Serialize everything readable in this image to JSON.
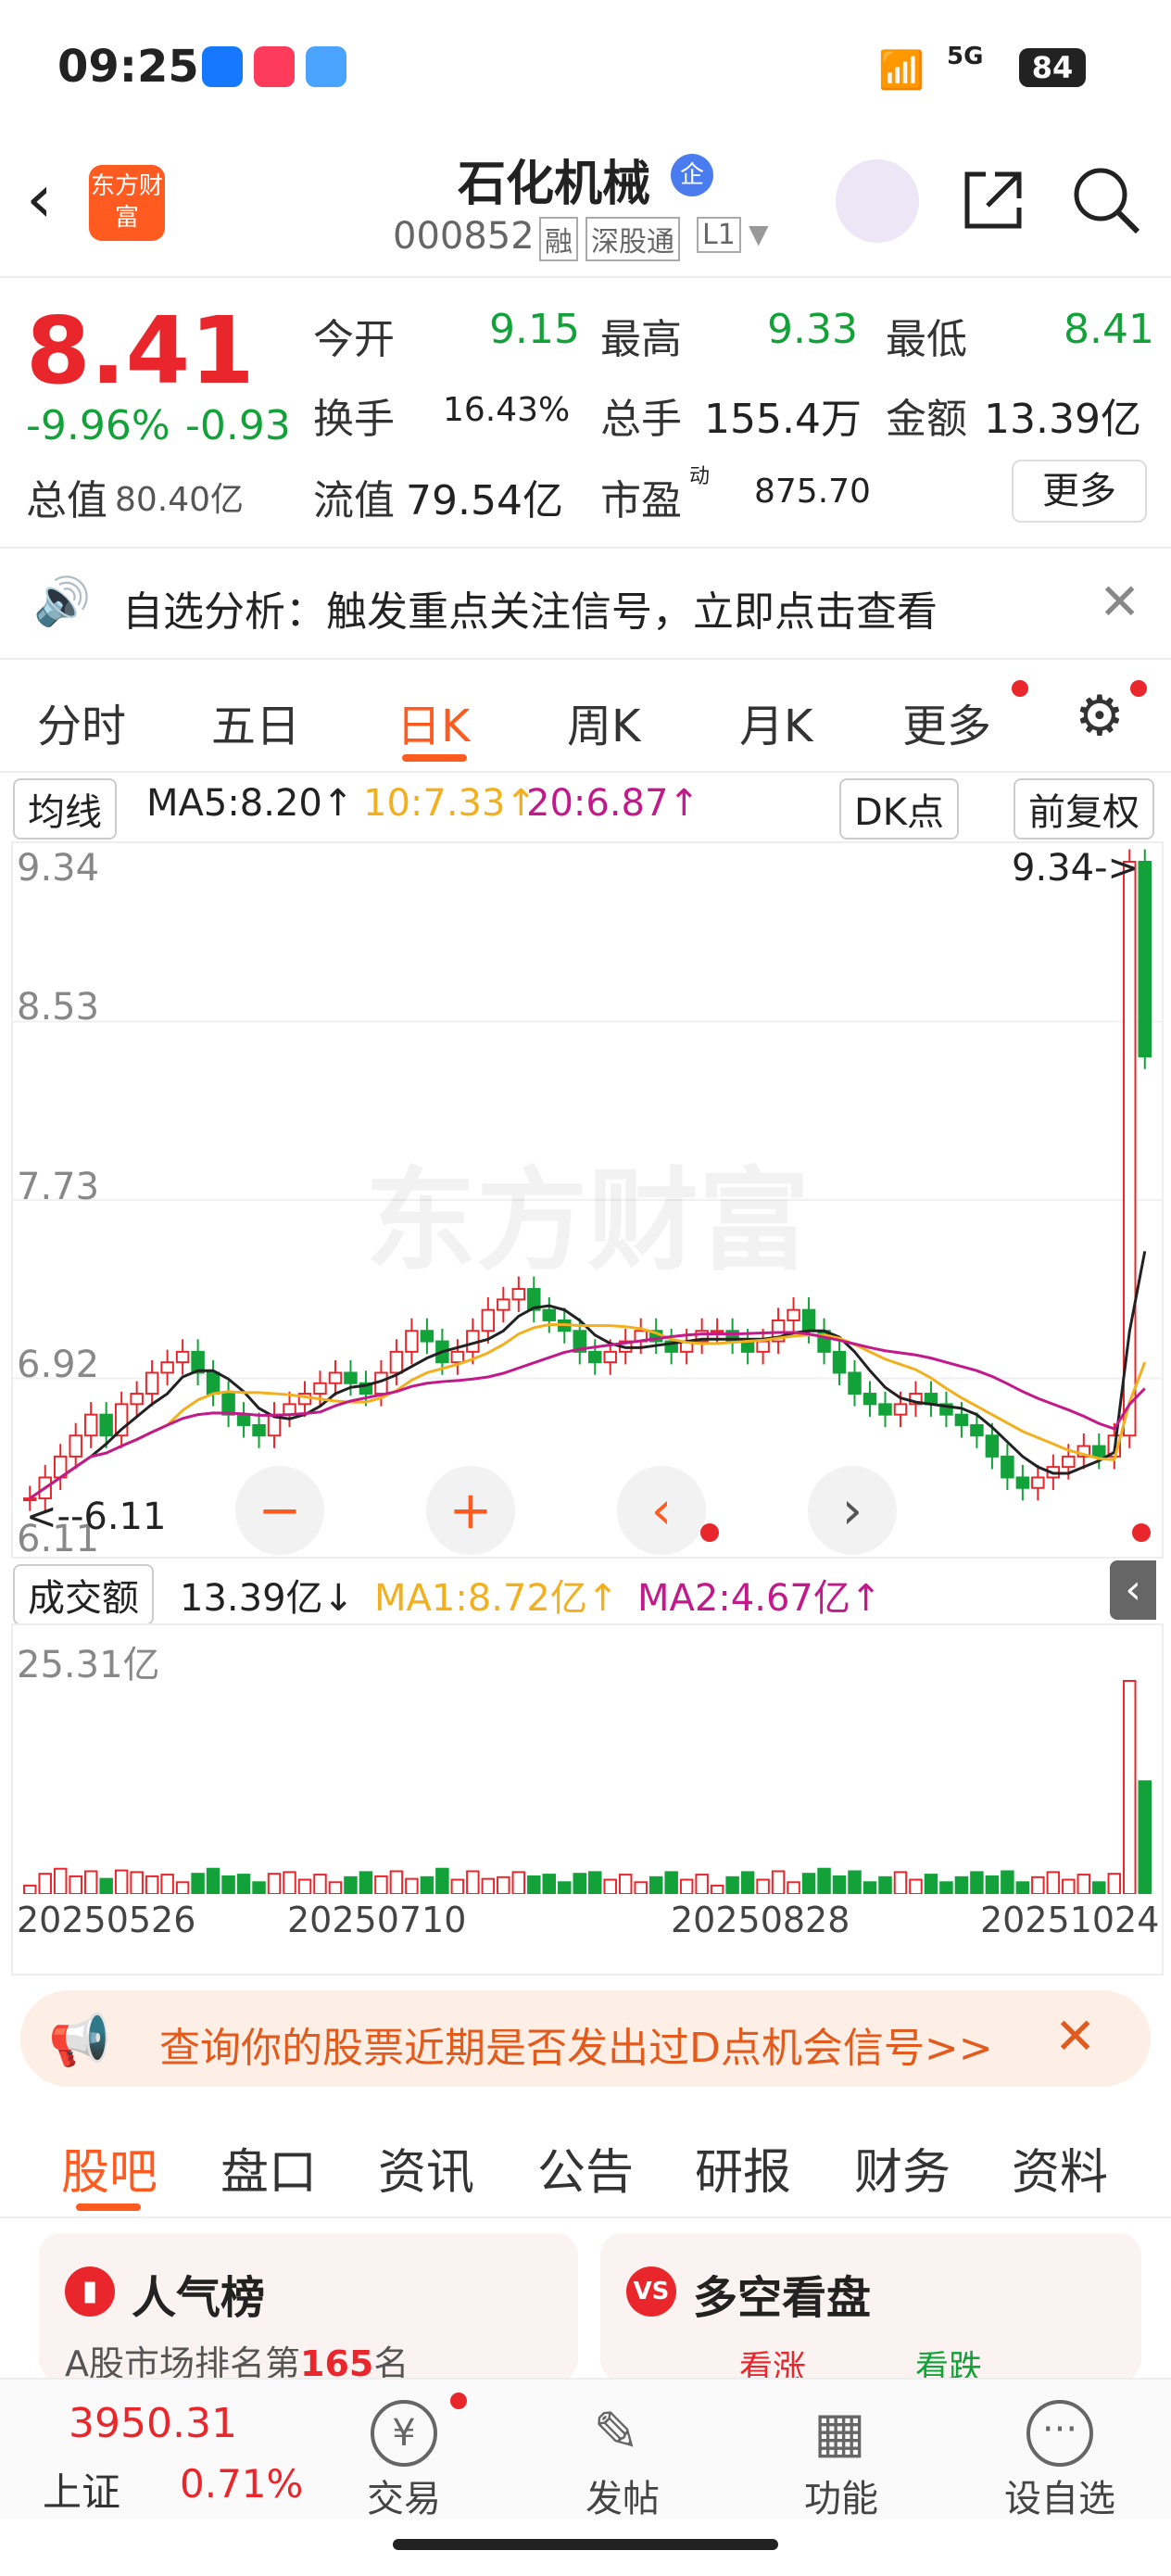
{
  "status": {
    "time": "09:25",
    "signal": "5G",
    "battery": "84"
  },
  "header": {
    "logo": "东方财富",
    "title": "石化机械",
    "badge": "企",
    "code": "000852",
    "tags": [
      "融",
      "深股通",
      "L1"
    ]
  },
  "quote": {
    "price": "8.41",
    "pct": "-9.96%",
    "chg": "-0.93",
    "open_label": "今开",
    "open": "9.15",
    "high_label": "最高",
    "high": "9.33",
    "low_label": "最低",
    "low": "8.41",
    "turnover_label": "换手",
    "turnover": "16.43%",
    "vol_label": "总手",
    "vol": "155.4万",
    "amt_label": "金额",
    "amt": "13.39亿",
    "mcap_label": "总值",
    "mcap": "80.40亿",
    "fcap_label": "流值",
    "fcap": "79.54亿",
    "pe_label": "市盈",
    "pe_sup": "动",
    "pe": "875.70",
    "more": "更多"
  },
  "alert": {
    "text": "自选分析：触发重点关注信号，立即点击查看"
  },
  "tabs": [
    "分时",
    "五日",
    "日K",
    "周K",
    "月K",
    "更多"
  ],
  "chart": {
    "ma_select": "均线",
    "ma5": "MA5:8.20↑",
    "ma10": "10:7.33↑",
    "ma20": "20:6.87↑",
    "dk": "DK点",
    "fq": "前复权",
    "ytick_top": "9.34",
    "ytick_2": "8.53",
    "ytick_3": "7.73",
    "ytick_4": "6.92",
    "high_mark": "9.34->",
    "low_mark": "<--6.11",
    "low_axis": "6.11",
    "watermark": "东方财富",
    "vol_select": "成交额",
    "vol_val": "13.39亿↓",
    "ma1": "MA1:8.72亿↑",
    "ma2": "MA2:4.67亿↑",
    "vol_top": "25.31亿",
    "dates": [
      "20250526",
      "20250710",
      "20250828",
      "20251024"
    ]
  },
  "chart_data": {
    "type": "candlestick",
    "price_ylim": [
      6.11,
      9.34
    ],
    "close_approx": [
      6.3,
      6.4,
      6.5,
      6.6,
      6.7,
      6.6,
      6.75,
      6.8,
      6.9,
      6.95,
      7.0,
      6.9,
      6.8,
      6.7,
      6.65,
      6.6,
      6.7,
      6.75,
      6.8,
      6.85,
      6.9,
      6.85,
      6.8,
      6.9,
      7.0,
      7.1,
      7.05,
      6.95,
      7.0,
      7.1,
      7.2,
      7.25,
      7.3,
      7.2,
      7.15,
      7.1,
      7.0,
      6.95,
      7.0,
      7.05,
      7.1,
      7.05,
      7.0,
      7.05,
      7.1,
      7.1,
      7.05,
      7.0,
      7.05,
      7.15,
      7.2,
      7.1,
      7.0,
      6.9,
      6.8,
      6.75,
      6.7,
      6.75,
      6.8,
      6.75,
      6.7,
      6.65,
      6.6,
      6.5,
      6.4,
      6.35,
      6.4,
      6.45,
      6.5,
      6.55,
      6.5,
      6.6,
      9.34,
      8.41
    ],
    "volume_ylim_yi": [
      0,
      25.31
    ],
    "last_amount_yi": 13.39
  },
  "banner": {
    "text": "查询你的股票近期是否发出过D点机会信号>>"
  },
  "btabs": [
    "股吧",
    "盘口",
    "资讯",
    "公告",
    "研报",
    "财务",
    "资料"
  ],
  "cards": {
    "left_title": "人气榜",
    "left_sub_prefix": "A股市场排名第",
    "left_rank": "165",
    "left_sub_suffix": "名",
    "right_title": "多空看盘",
    "right_a": "看涨",
    "right_b": "看跌"
  },
  "bottom": {
    "index_value": "3950.31",
    "index_name": "上证",
    "index_pct": "0.71%",
    "items": [
      "交易",
      "发帖",
      "功能",
      "设自选"
    ]
  },
  "colors": {
    "up": "#e8262b",
    "down": "#13a23a",
    "accent": "#ff5a1f"
  }
}
